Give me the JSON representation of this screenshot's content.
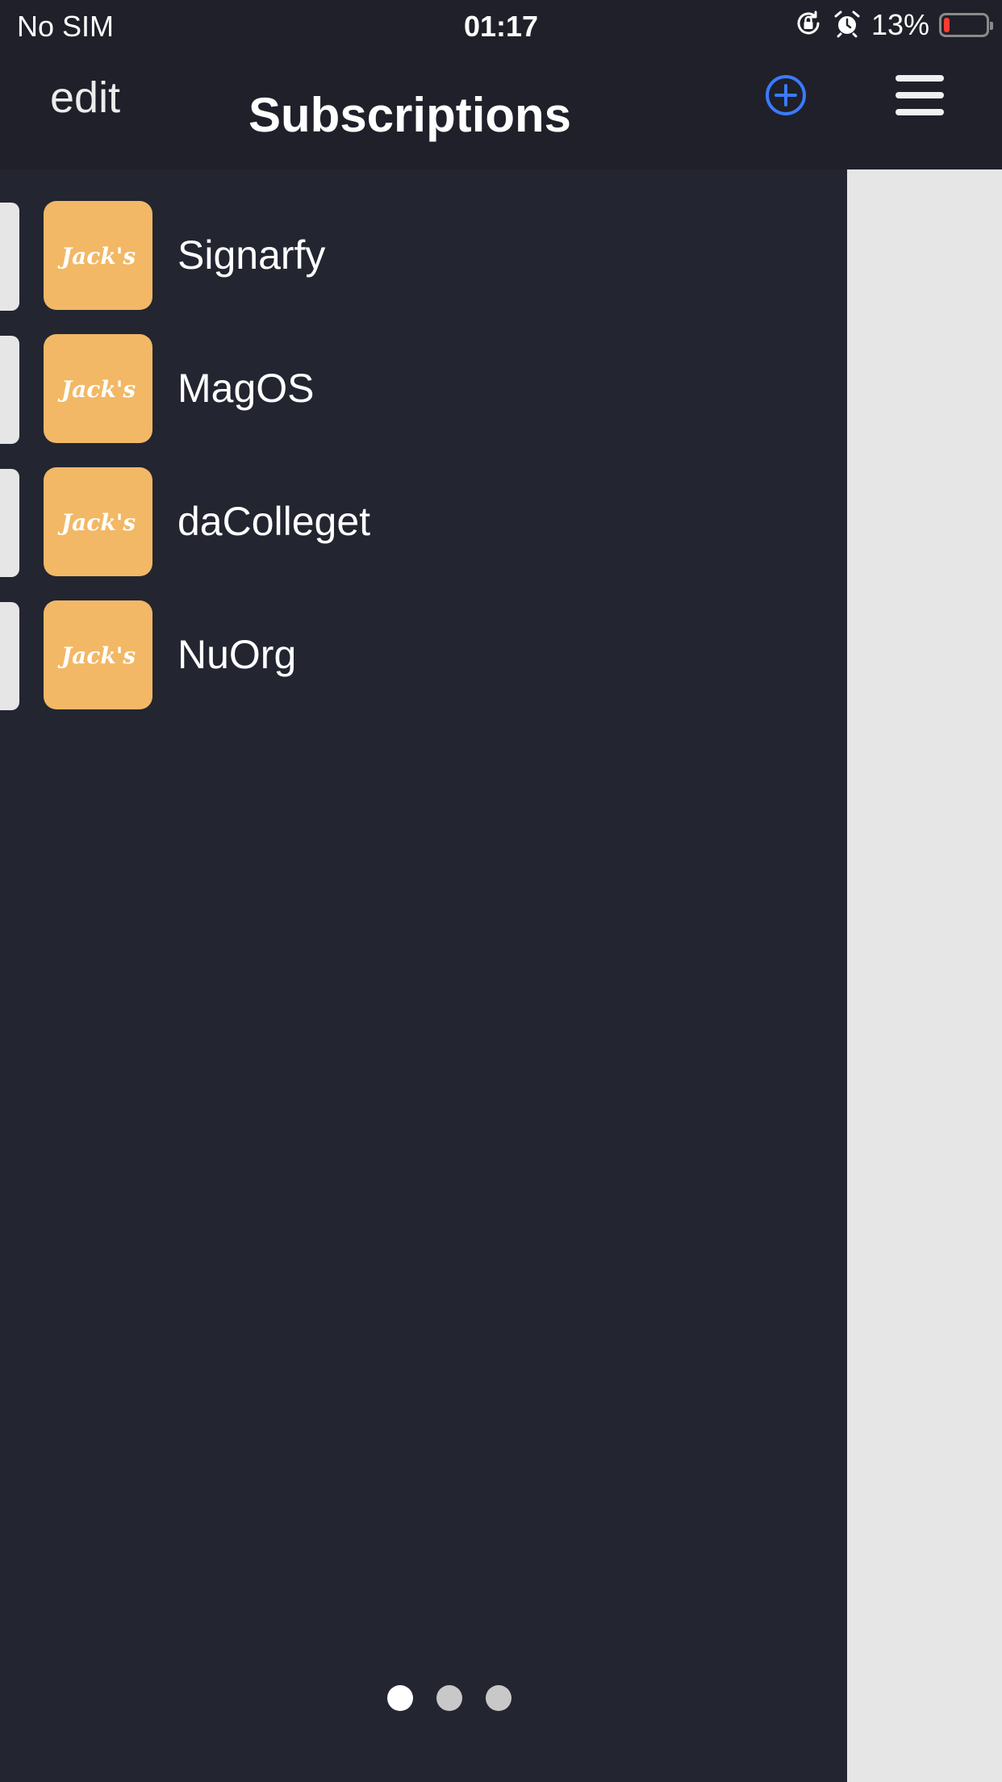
{
  "status_bar": {
    "carrier": "No SIM",
    "time": "01:17",
    "battery_percent_text": "13%",
    "battery_level": 0.13,
    "icons": [
      "orientation-lock-icon",
      "alarm-icon",
      "battery-icon"
    ]
  },
  "nav": {
    "edit_label": "edit",
    "title": "Subscriptions",
    "icons": [
      "add-circle-icon",
      "hamburger-menu-icon"
    ]
  },
  "subscriptions": [
    {
      "name": "Signarfy",
      "logo_text": "Jack's"
    },
    {
      "name": "MagOS",
      "logo_text": "Jack's"
    },
    {
      "name": "daColleget",
      "logo_text": "Jack's"
    },
    {
      "name": "NuOrg",
      "logo_text": "Jack's"
    }
  ],
  "pagination": {
    "pages": 3,
    "current": 1
  },
  "colors": {
    "accent": "#3a7bfd",
    "background": "#232531",
    "nav_background": "#1f2029",
    "logo_background": "#f2b865",
    "battery_low": "#ff3b30",
    "side_panel": "#e6e6e6"
  }
}
